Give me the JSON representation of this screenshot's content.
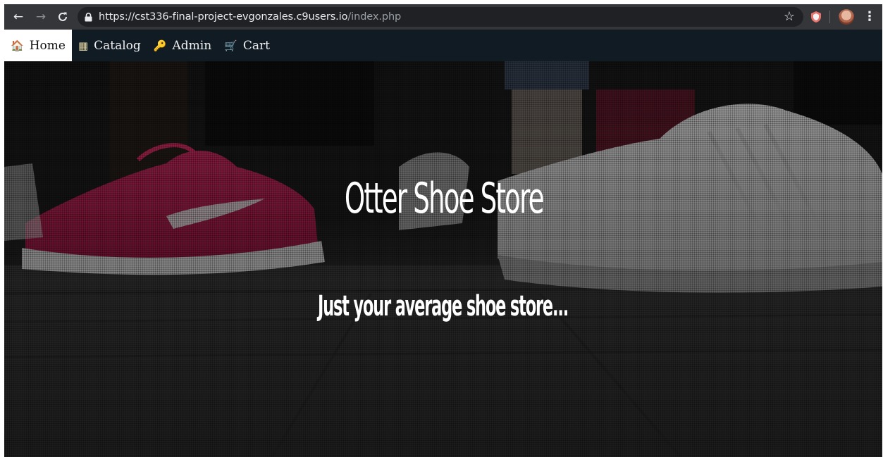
{
  "browser": {
    "url_main": "https://cst336-final-project-evgonzales.c9users.io",
    "url_path": "/index.php",
    "icons": {
      "back": "←",
      "forward": "→",
      "reload": "⟳",
      "lock": "🔒",
      "star": "☆",
      "shield": "⛊",
      "menu": "⋮"
    }
  },
  "nav": {
    "items": [
      {
        "icon": "🏠",
        "label": "Home",
        "active": true
      },
      {
        "icon": "▦",
        "label": "Catalog",
        "active": false
      },
      {
        "icon": "🔑",
        "label": "Admin",
        "active": false
      },
      {
        "icon": "🛒",
        "label": "Cart",
        "active": false
      }
    ]
  },
  "hero": {
    "title": "Otter Shoe Store",
    "subtitle": "Just your average shoe store..."
  },
  "colors": {
    "nav_bg": "#111b24",
    "toolbar_bg": "#35363a",
    "omnibox_bg": "#202124",
    "accent_shoe": "#c8255c"
  }
}
